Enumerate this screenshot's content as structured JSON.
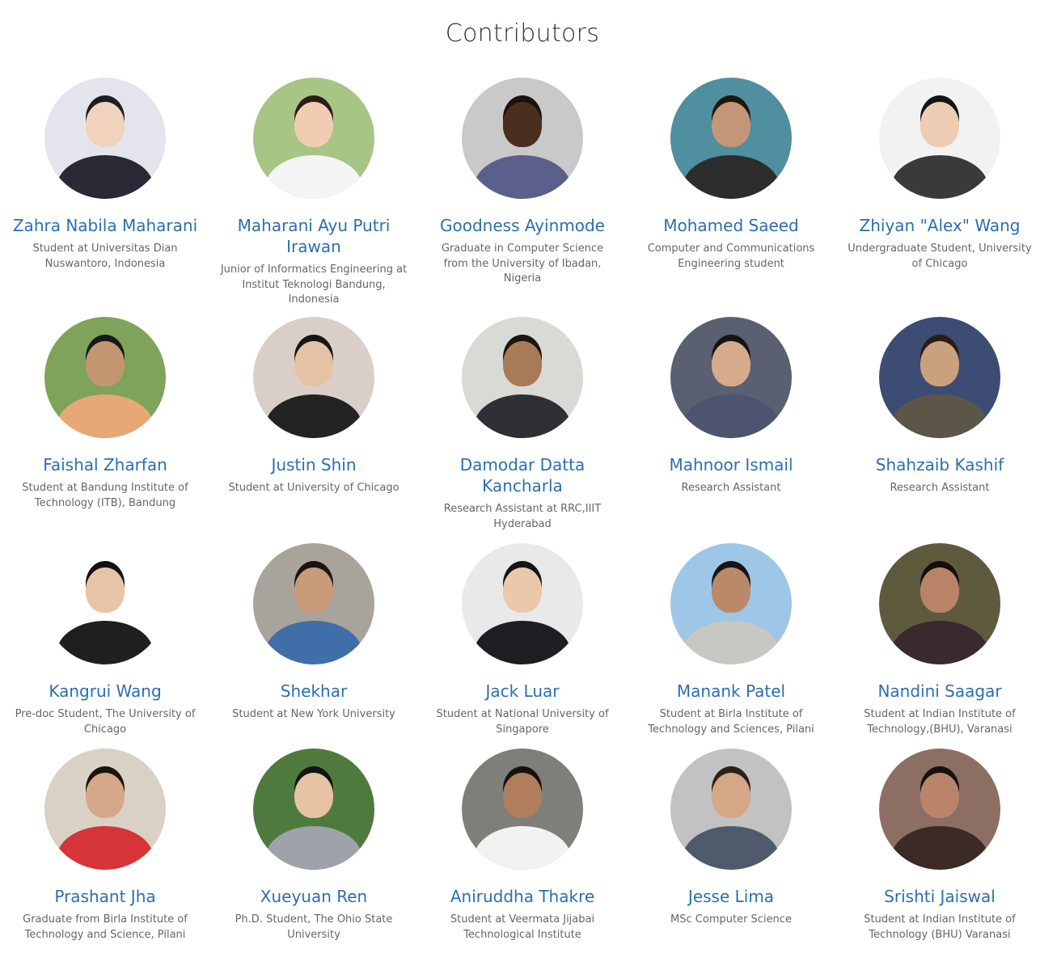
{
  "page": {
    "title": "Contributors"
  },
  "contributors": [
    {
      "name": "Zahra Nabila Maharani",
      "desc": "Student at Universitas Dian Nuswantoro, Indonesia",
      "photo": {
        "bg": "#e4e4ec",
        "skin": "#f1d3bc",
        "cloth": "#2a2a36",
        "hair": "#1c1c24"
      }
    },
    {
      "name": "Maharani Ayu Putri Irawan",
      "desc": "Junior of Informatics Engineering at Institut Teknologi Bandung, Indonesia",
      "photo": {
        "bg": "#a7c585",
        "skin": "#f0cdb2",
        "cloth": "#f4f4f4",
        "hair": "#2b1d14"
      }
    },
    {
      "name": "Goodness Ayinmode",
      "desc": "Graduate in Computer Science from the University of Ibadan, Nigeria",
      "photo": {
        "bg": "#c9c9c9",
        "skin": "#4a2e1e",
        "cloth": "#5b5f8c",
        "hair": "#1b120c"
      }
    },
    {
      "name": "Mohamed Saeed",
      "desc": "Computer and Communications Engineering student",
      "photo": {
        "bg": "#4f8fa0",
        "skin": "#c49678",
        "cloth": "#2d2d2d",
        "hair": "#1e1711"
      }
    },
    {
      "name": "Zhiyan \"Alex\" Wang",
      "desc": "Undergraduate Student, University of Chicago",
      "photo": {
        "bg": "#f2f2f2",
        "skin": "#ecccb3",
        "cloth": "#3a3a3a",
        "hair": "#141414"
      }
    },
    {
      "name": "Faishal Zharfan",
      "desc": "Student at Bandung Institute of Technology (ITB), Bandung",
      "photo": {
        "bg": "#7fa35a",
        "skin": "#c49670",
        "cloth": "#e7a878",
        "hair": "#181818"
      }
    },
    {
      "name": "Justin Shin",
      "desc": "Student at University of Chicago",
      "photo": {
        "bg": "#d9cfc8",
        "skin": "#e6c2a4",
        "cloth": "#232323",
        "hair": "#161616"
      }
    },
    {
      "name": "Damodar Datta Kancharla",
      "desc": "Research Assistant at RRC,IIIT Hyderabad",
      "photo": {
        "bg": "#d8dad5",
        "skin": "#a97a56",
        "cloth": "#2e3036",
        "hair": "#1c1410"
      }
    },
    {
      "name": "Mahnoor Ismail",
      "desc": "Research Assistant",
      "photo": {
        "bg": "#5a6072",
        "skin": "#d6ab8c",
        "cloth": "#4c5470",
        "hair": "#1a1410"
      }
    },
    {
      "name": "Shahzaib Kashif",
      "desc": "Research Assistant",
      "photo": {
        "bg": "#3d4c73",
        "skin": "#c9a17e",
        "cloth": "#5c5648",
        "hair": "#2a1d14"
      }
    },
    {
      "name": "Kangrui Wang",
      "desc": "Pre-doc Student, The University of Chicago",
      "photo": {
        "bg": "#ffffff",
        "skin": "#e8c4a6",
        "cloth": "#1f1f1f",
        "hair": "#111111"
      }
    },
    {
      "name": "Shekhar",
      "desc": "Student at New York University",
      "photo": {
        "bg": "#a8a49c",
        "skin": "#c99a78",
        "cloth": "#3f6ea8",
        "hair": "#1c1410"
      }
    },
    {
      "name": "Jack Luar",
      "desc": "Student at National University of Singapore",
      "photo": {
        "bg": "#e9e9e9",
        "skin": "#eac8aa",
        "cloth": "#1e1e22",
        "hair": "#151515"
      }
    },
    {
      "name": "Manank Patel",
      "desc": "Student at Birla Institute of Technology and Sciences, Pilani",
      "photo": {
        "bg": "#9ec6e6",
        "skin": "#b9896a",
        "cloth": "#c8c8c2",
        "hair": "#1a1410"
      }
    },
    {
      "name": "Nandini Saagar",
      "desc": "Student at Indian Institute of Technology,(BHU), Varanasi",
      "photo": {
        "bg": "#5d5a3e",
        "skin": "#b88366",
        "cloth": "#3a2a30",
        "hair": "#150f0c"
      }
    },
    {
      "name": "Prashant Jha",
      "desc": "Graduate from Birla Institute of Technology and Science, Pilani",
      "photo": {
        "bg": "#d9d2c4",
        "skin": "#d6a788",
        "cloth": "#d7343a",
        "hair": "#1b1512"
      }
    },
    {
      "name": "Xueyuan Ren",
      "desc": "Ph.D. Student, The Ohio State University",
      "photo": {
        "bg": "#4f7a3e",
        "skin": "#e6c3a3",
        "cloth": "#9ea3ab",
        "hair": "#141414"
      }
    },
    {
      "name": "Aniruddha Thakre",
      "desc": "Student at Veermata Jijabai Technological Institute",
      "photo": {
        "bg": "#7f7f7a",
        "skin": "#b07e5c",
        "cloth": "#f2f2f2",
        "hair": "#161210"
      }
    },
    {
      "name": "Jesse Lima",
      "desc": "MSc Computer Science",
      "photo": {
        "bg": "#c2c2c2",
        "skin": "#d4a787",
        "cloth": "#4f5a6c",
        "hair": "#2a211a"
      }
    },
    {
      "name": "Srishti Jaiswal",
      "desc": "Student at Indian Institute of Technology (BHU) Varanasi",
      "photo": {
        "bg": "#8c6f62",
        "skin": "#b98469",
        "cloth": "#3b2a26",
        "hair": "#171110"
      }
    }
  ]
}
